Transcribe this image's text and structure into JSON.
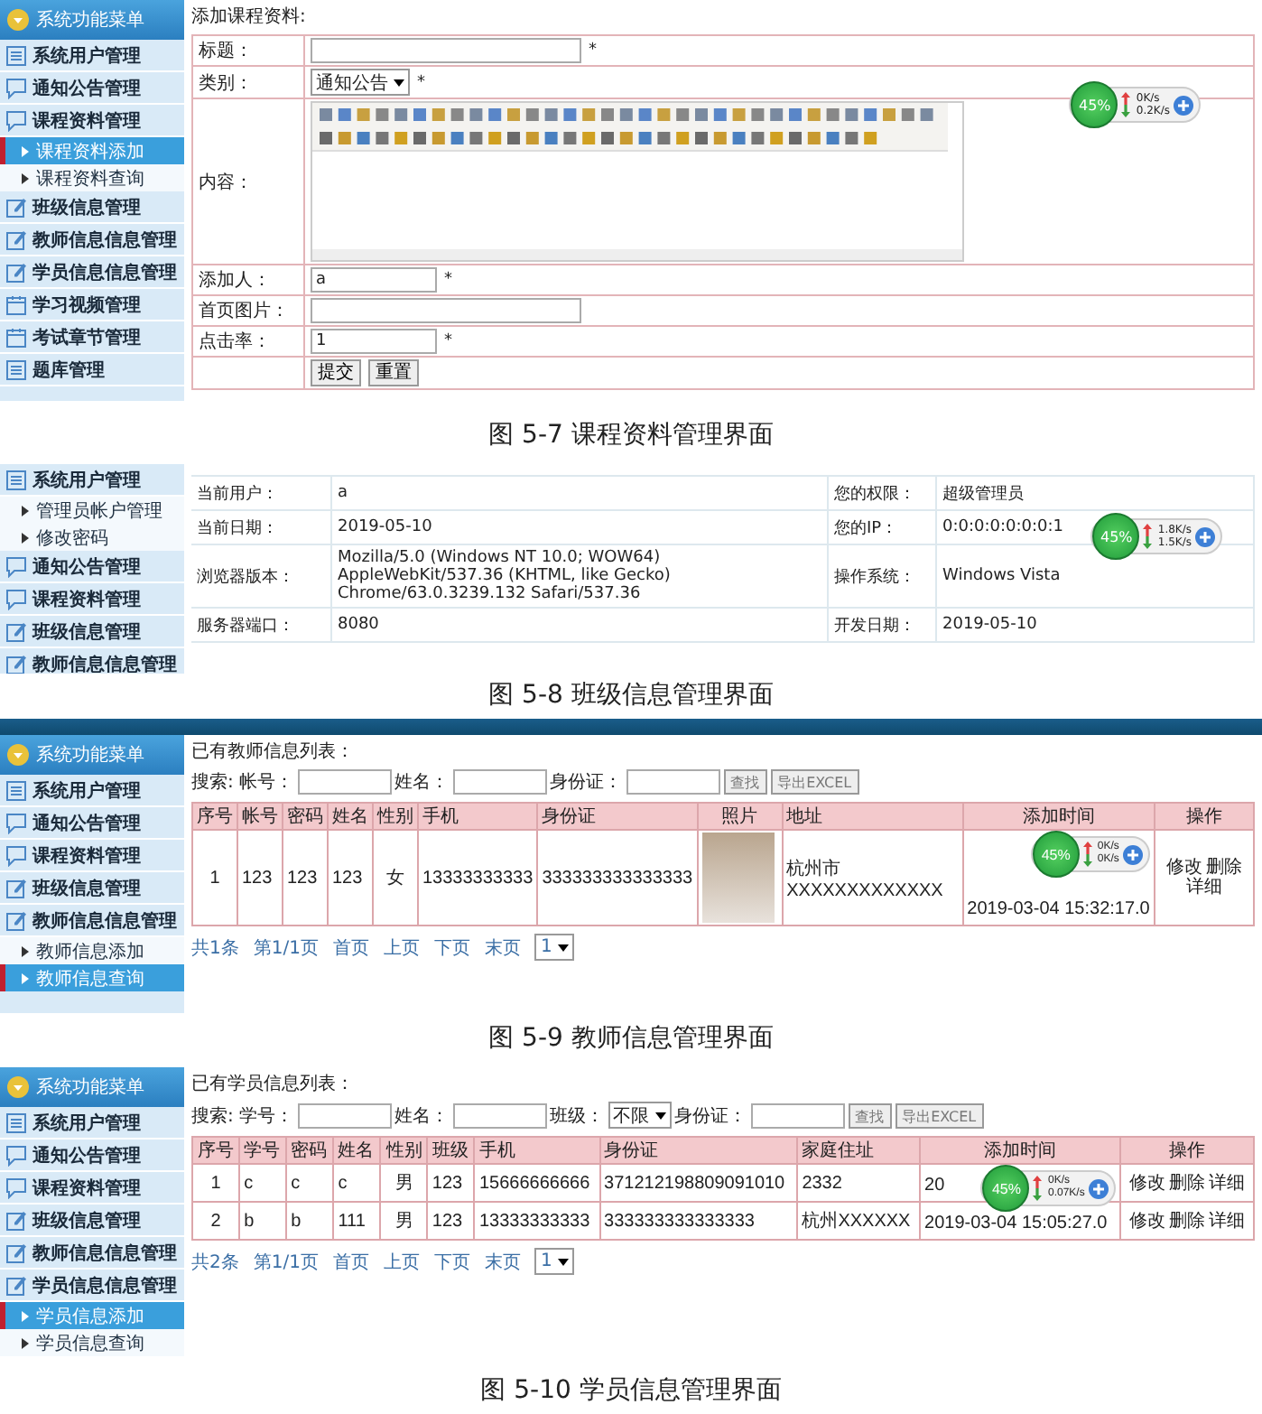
{
  "figures": [
    {
      "kind": "form",
      "caption": "图 5-7 课程资料管理界面",
      "sidebar": {
        "header": "系统功能菜单",
        "items": [
          {
            "label": "系统用户管理",
            "kind": "list",
            "selected": false
          },
          {
            "label": "通知公告管理",
            "kind": "chat",
            "selected": false
          },
          {
            "label": "课程资料管理",
            "kind": "chat",
            "selected": false,
            "children": [
              {
                "label": "课程资料添加",
                "selected": true
              },
              {
                "label": "课程资料查询",
                "selected": false
              }
            ]
          },
          {
            "label": "班级信息管理",
            "kind": "edit",
            "selected": false
          },
          {
            "label": "教师信息信息管理",
            "kind": "edit",
            "selected": false
          },
          {
            "label": "学员信息信息管理",
            "kind": "edit",
            "selected": false
          },
          {
            "label": "学习视频管理",
            "kind": "calendar",
            "selected": false
          },
          {
            "label": "考试章节管理",
            "kind": "calendar",
            "selected": false
          },
          {
            "label": "题库管理",
            "kind": "list",
            "selected": false
          }
        ]
      },
      "main": {
        "heading": "添加课程资料:",
        "widget": {
          "percent": "45%",
          "up": "0K/s",
          "down": "0.2K/s"
        },
        "rows": [
          {
            "label": "标题：",
            "kind": "wide-text",
            "mark": "*"
          },
          {
            "label": "类别：",
            "kind": "select",
            "value": "通知公告",
            "mark": "*"
          },
          {
            "label": "内容：",
            "kind": "editor"
          },
          {
            "label": "添加人：",
            "kind": "text",
            "value": "a",
            "mark": "*"
          },
          {
            "label": "首页图片：",
            "kind": "wide-text"
          },
          {
            "label": "点击率：",
            "kind": "text",
            "value": "1",
            "mark": "*"
          },
          {
            "kind": "buttons",
            "buttons": [
              "提交",
              "重置"
            ]
          }
        ]
      }
    },
    {
      "kind": "info",
      "caption": "图 5-8 班级信息管理界面",
      "sidebar": {
        "items": [
          {
            "label": "系统用户管理",
            "kind": "list",
            "selected": false,
            "children": [
              {
                "label": "管理员帐户管理",
                "selected": false
              },
              {
                "label": "修改密码",
                "selected": false
              }
            ]
          },
          {
            "label": "通知公告管理",
            "kind": "chat",
            "selected": false
          },
          {
            "label": "课程资料管理",
            "kind": "chat",
            "selected": false
          },
          {
            "label": "班级信息管理",
            "kind": "edit",
            "selected": false
          },
          {
            "label": "教师信息信息管理",
            "kind": "edit",
            "selected": false
          }
        ]
      },
      "main": {
        "widget": {
          "percent": "45%",
          "up": "1.8K/s",
          "down": "1.5K/s"
        },
        "rows": [
          [
            "当前用户：",
            "a",
            "您的权限：",
            "超级管理员"
          ],
          [
            "当前日期：",
            "2019-05-10",
            "您的IP：",
            "0:0:0:0:0:0:0:1"
          ],
          [
            "浏览器版本：",
            "Mozilla/5.0 (Windows NT 10.0; WOW64) AppleWebKit/537.36 (KHTML, like Gecko) Chrome/63.0.3239.132 Safari/537.36",
            "操作系统：",
            "Windows Vista"
          ],
          [
            "服务器端口：",
            "8080",
            "开发日期：",
            "2019-05-10"
          ]
        ]
      }
    },
    {
      "kind": "list",
      "caption": "图 5-9 教师信息管理界面",
      "top_bar": true,
      "sidebar": {
        "header": "系统功能菜单",
        "items": [
          {
            "label": "系统用户管理",
            "kind": "list",
            "selected": false
          },
          {
            "label": "通知公告管理",
            "kind": "chat",
            "selected": false
          },
          {
            "label": "课程资料管理",
            "kind": "chat",
            "selected": false
          },
          {
            "label": "班级信息管理",
            "kind": "edit",
            "selected": false
          },
          {
            "label": "教师信息信息管理",
            "kind": "edit",
            "selected": false,
            "children": [
              {
                "label": "教师信息添加",
                "selected": false
              },
              {
                "label": "教师信息查询",
                "selected": true
              }
            ]
          }
        ]
      },
      "main": {
        "heading": "已有教师信息列表：",
        "widget": {
          "percent": "45%",
          "up": "0K/s",
          "down": "0K/s"
        },
        "search": [
          {
            "kind": "label",
            "text": "搜索: 帐号："
          },
          {
            "kind": "input"
          },
          {
            "kind": "label",
            "text": "姓名："
          },
          {
            "kind": "input"
          },
          {
            "kind": "label",
            "text": "身份证："
          },
          {
            "kind": "input"
          },
          {
            "kind": "button",
            "text": "查找"
          },
          {
            "kind": "button",
            "text": "导出EXCEL"
          }
        ],
        "columns": [
          {
            "label": "序号",
            "kind": "center"
          },
          {
            "label": "帐号",
            "kind": "text"
          },
          {
            "label": "密码",
            "kind": "text"
          },
          {
            "label": "姓名",
            "kind": "text"
          },
          {
            "label": "性别",
            "kind": "center"
          },
          {
            "label": "手机",
            "kind": "text"
          },
          {
            "label": "身份证",
            "kind": "text"
          },
          {
            "label": "照片",
            "kind": "photo"
          },
          {
            "label": "地址",
            "kind": "text"
          },
          {
            "label": "添加时间",
            "kind": "time"
          },
          {
            "label": "操作",
            "kind": "actions"
          }
        ],
        "rows": [
          {
            "cells": [
              "1",
              "123",
              "123",
              "123",
              "女",
              "13333333333",
              "333333333333333",
              "",
              "杭州市XXXXXXXXXXXXX",
              "2019-03-04 15:32:17.0",
              [
                "修改",
                "删除",
                "详细"
              ]
            ]
          }
        ],
        "pager": {
          "items": [
            "共1条",
            "第1/1页",
            "首页",
            "上页",
            "下页",
            "末页"
          ],
          "page": "1"
        }
      }
    },
    {
      "kind": "list",
      "caption": "图 5-10 学员信息管理界面",
      "sidebar": {
        "header": "系统功能菜单",
        "items": [
          {
            "label": "系统用户管理",
            "kind": "list",
            "selected": false
          },
          {
            "label": "通知公告管理",
            "kind": "chat",
            "selected": false
          },
          {
            "label": "课程资料管理",
            "kind": "chat",
            "selected": false
          },
          {
            "label": "班级信息管理",
            "kind": "edit",
            "selected": false
          },
          {
            "label": "教师信息信息管理",
            "kind": "edit",
            "selected": false
          },
          {
            "label": "学员信息信息管理",
            "kind": "edit",
            "selected": false,
            "children": [
              {
                "label": "学员信息添加",
                "selected": true
              },
              {
                "label": "学员信息查询",
                "selected": false
              }
            ]
          }
        ]
      },
      "main": {
        "heading": "已有学员信息列表：",
        "widget": {
          "percent": "45%",
          "up": "0K/s",
          "down": "0.07K/s"
        },
        "search": [
          {
            "kind": "label",
            "text": "搜索: 学号："
          },
          {
            "kind": "input"
          },
          {
            "kind": "label",
            "text": "姓名："
          },
          {
            "kind": "input"
          },
          {
            "kind": "label",
            "text": "班级："
          },
          {
            "kind": "select",
            "value": "不限"
          },
          {
            "kind": "label",
            "text": "身份证："
          },
          {
            "kind": "input"
          },
          {
            "kind": "button",
            "text": "查找"
          },
          {
            "kind": "button",
            "text": "导出EXCEL"
          }
        ],
        "columns": [
          {
            "label": "序号",
            "kind": "center"
          },
          {
            "label": "学号",
            "kind": "text"
          },
          {
            "label": "密码",
            "kind": "text"
          },
          {
            "label": "姓名",
            "kind": "text"
          },
          {
            "label": "性别",
            "kind": "center"
          },
          {
            "label": "班级",
            "kind": "text"
          },
          {
            "label": "手机",
            "kind": "text"
          },
          {
            "label": "身份证",
            "kind": "text"
          },
          {
            "label": "家庭住址",
            "kind": "text"
          },
          {
            "label": "添加时间",
            "kind": "time"
          },
          {
            "label": "操作",
            "kind": "actions"
          }
        ],
        "rows": [
          {
            "cells": [
              "1",
              "c",
              "c",
              "c",
              "男",
              "123",
              "15666666666",
              "371212198809091010",
              "2332",
              "20",
              [
                "修改",
                "删除",
                "详细"
              ]
            ]
          },
          {
            "cells": [
              "2",
              "b",
              "b",
              "111",
              "男",
              "123",
              "13333333333",
              "333333333333333",
              "杭州XXXXXX",
              "2019-03-04 15:05:27.0",
              [
                "修改",
                "删除",
                "详细"
              ]
            ]
          }
        ],
        "pager": {
          "items": [
            "共2条",
            "第1/1页",
            "首页",
            "上页",
            "下页",
            "末页"
          ],
          "page": "1"
        }
      }
    }
  ]
}
